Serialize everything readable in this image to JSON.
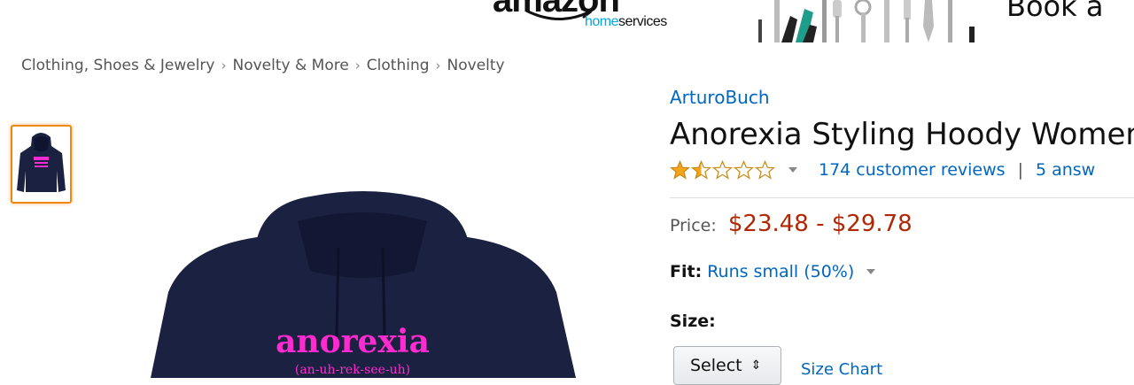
{
  "ad_banner": {
    "brand_word": "amazon",
    "brand_sub_home": "home",
    "brand_sub_services": "services",
    "cta_text": "Book a"
  },
  "breadcrumb": [
    "Clothing, Shoes & Jewelry",
    "Novelty & More",
    "Clothing",
    "Novelty"
  ],
  "breadcrumb_separator": "›",
  "product": {
    "brand": "ArturoBuch",
    "title": "Anorexia Styling Hoody Women",
    "rating_stars": 1.5,
    "rating_max": 5,
    "reviews_link": "174 customer reviews",
    "pipe": "|",
    "answered_link": "5 answ",
    "price_label": "Price:",
    "price_value": "$23.48 - $29.78",
    "fit_label": "Fit:",
    "fit_value": "Runs small (50%)",
    "size_label": "Size:",
    "size_select": "Select",
    "size_chart_link": "Size Chart",
    "image_print_main": "anorexia",
    "image_print_sub": "(an-uh-rek-see-uh)"
  },
  "colors": {
    "link": "#0066c0",
    "price": "#b12704",
    "hoodie": "#1b2140",
    "print": "#ff2ad0",
    "thumb_border": "#f08804",
    "star": "#f4a41d"
  }
}
